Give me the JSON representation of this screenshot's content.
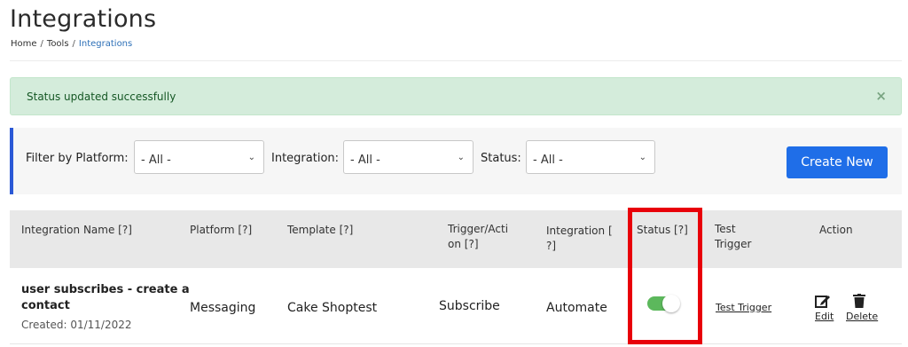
{
  "page": {
    "title": "Integrations",
    "breadcrumb": [
      "Home",
      "Tools",
      "Integrations"
    ]
  },
  "alert": {
    "message": "Status updated successfully",
    "close_glyph": "×"
  },
  "filters": {
    "platform_label": "Filter by Platform:",
    "platform_value": "- All -",
    "integration_label": "Integration:",
    "integration_value": "- All -",
    "status_label": "Status:",
    "status_value": "- All -",
    "create_label": "Create New"
  },
  "table": {
    "headers": {
      "name": "Integration Name [?]",
      "platform": "Platform [?]",
      "template": "Template [?]",
      "trigger_line1": "Trigger/Acti",
      "trigger_line2": "on [?]",
      "integration_line1": "Integration [",
      "integration_line2": "?]",
      "status": "Status [?]",
      "test_line1": "Test",
      "test_line2": "Trigger",
      "action": "Action"
    },
    "rows": [
      {
        "name_line1": "user subscribes - create a",
        "name_line2": "contact",
        "created": "Created: 01/11/2022",
        "platform": "Messaging",
        "template": "Cake Shoptest",
        "trigger": "Subscribe",
        "integration": "Automate",
        "status_on": true,
        "test_trigger": "Test Trigger",
        "edit": "Edit",
        "delete": "Delete"
      }
    ]
  },
  "colors": {
    "primary": "#1f6ee8",
    "toggle_on": "#5cb85c",
    "alert_bg": "#d4ecdb",
    "highlight": "#e8000a"
  },
  "icons": {
    "select_chevron": "chevron-down-icon",
    "edit": "edit-icon",
    "delete": "trash-icon"
  }
}
